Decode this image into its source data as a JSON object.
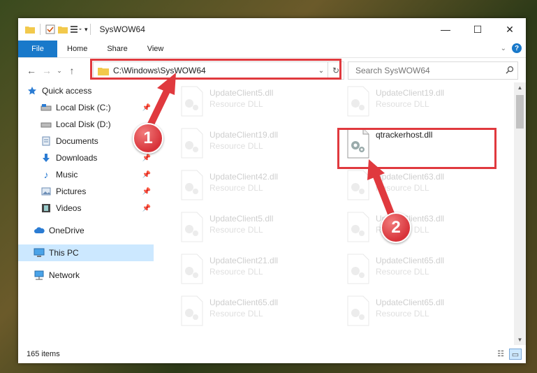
{
  "window": {
    "title": "SysWOW64",
    "minimize": "—",
    "maximize": "☐",
    "close": "✕"
  },
  "ribbon": {
    "tabs": [
      "File",
      "Home",
      "Share",
      "View"
    ]
  },
  "address": {
    "path": "C:\\Windows\\SysWOW64"
  },
  "search": {
    "placeholder": "Search SysWOW64"
  },
  "sidebar": {
    "items": [
      {
        "label": "Quick access",
        "icon": "star-icon"
      },
      {
        "label": "Local Disk (C:)",
        "icon": "drive-icon"
      },
      {
        "label": "Local Disk (D:)",
        "icon": "drive-icon"
      },
      {
        "label": "Documents",
        "icon": "documents-icon"
      },
      {
        "label": "Downloads",
        "icon": "download-icon"
      },
      {
        "label": "Music",
        "icon": "music-icon"
      },
      {
        "label": "Pictures",
        "icon": "pictures-icon"
      },
      {
        "label": "Videos",
        "icon": "videos-icon"
      },
      {
        "label": "OneDrive",
        "icon": "cloud-icon"
      },
      {
        "label": "This PC",
        "icon": "computer-icon"
      },
      {
        "label": "Network",
        "icon": "network-icon"
      }
    ]
  },
  "files": [
    {
      "name": "UpdateClient5.dll",
      "type": "Resource DLL"
    },
    {
      "name": "UpdateClient19.dll",
      "type": "Resource DLL"
    },
    {
      "name": "UpdateClient19.dll",
      "type": "Resource DLL"
    },
    {
      "name": "qtrackerhost.dll",
      "type": ""
    },
    {
      "name": "UpdateClient42.dll",
      "type": "Resource DLL"
    },
    {
      "name": "UpdateClient63.dll",
      "type": "Resource DLL"
    },
    {
      "name": "UpdateClient5.dll",
      "type": "Resource DLL"
    },
    {
      "name": "UpdateClient63.dll",
      "type": "Resource DLL"
    },
    {
      "name": "UpdateClient21.dll",
      "type": "Resource DLL"
    },
    {
      "name": "UpdateClient65.dll",
      "type": "Resource DLL"
    },
    {
      "name": "UpdateClient65.dll",
      "type": "Resource DLL"
    },
    {
      "name": "UpdateClient65.dll",
      "type": "Resource DLL"
    }
  ],
  "status": {
    "count": "165 items"
  },
  "annotations": {
    "badge1": "1",
    "badge2": "2"
  },
  "colors": {
    "accent": "#1979ca",
    "highlight": "#e0393e",
    "selected": "#cce8ff"
  }
}
